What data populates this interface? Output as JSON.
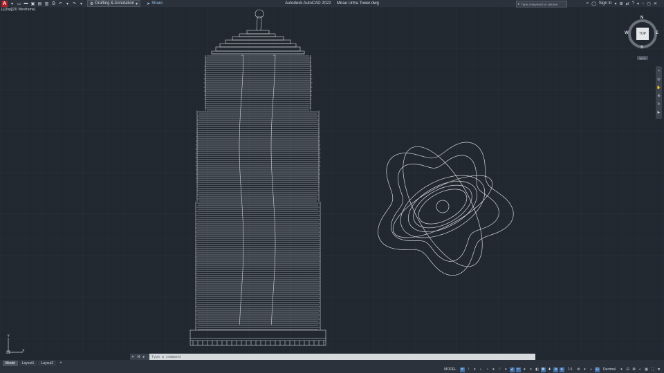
{
  "titlebar": {
    "app_title": "Autodesk AutoCAD 2022",
    "file_name": "Mirae Unha Tower.dwg",
    "workspace": "Drafting & Annotation",
    "share_label": "Share",
    "search_placeholder": "Type a keyword or phrase",
    "sign_in_label": "Sign In"
  },
  "viewport": {
    "label": "[-][Top][2D Wireframe]"
  },
  "viewcube": {
    "face": "TOP",
    "north": "N",
    "south": "S",
    "east": "E",
    "west": "W",
    "wcs_label": "WCS"
  },
  "ucs": {
    "x_label": "X",
    "y_label": "Y"
  },
  "command_line": {
    "placeholder": "Type a command"
  },
  "layout_tabs": [
    {
      "label": "Model",
      "active": true
    },
    {
      "label": "Layout1",
      "active": false
    },
    {
      "label": "Layout2",
      "active": false
    }
  ],
  "statusbar": {
    "model_label": "MODEL",
    "scale_label": "1:1",
    "units_label": "Decimal"
  },
  "colors": {
    "background": "#212830",
    "grid_minor": "#262d36",
    "grid_major": "#2d3540",
    "line_white": "#d6dade",
    "accent_blue": "#3f6fa8",
    "app_red": "#b01f24"
  }
}
